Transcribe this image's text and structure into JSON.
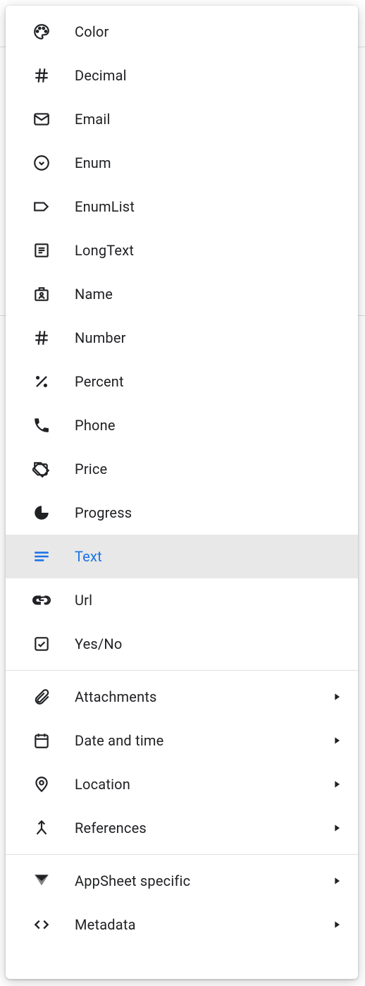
{
  "selected": "Text",
  "colors": {
    "text": "#202124",
    "accent": "#1a73e8",
    "selected_bg": "#e8e8e8",
    "divider": "#e0e0e0"
  },
  "groups": [
    {
      "name": "simple-types",
      "items": [
        {
          "label": "Color",
          "icon": "palette-icon"
        },
        {
          "label": "Decimal",
          "icon": "hash-icon"
        },
        {
          "label": "Email",
          "icon": "mail-icon"
        },
        {
          "label": "Enum",
          "icon": "circle-chevron-icon"
        },
        {
          "label": "EnumList",
          "icon": "label-icon"
        },
        {
          "label": "LongText",
          "icon": "document-lines-icon"
        },
        {
          "label": "Name",
          "icon": "badge-icon"
        },
        {
          "label": "Number",
          "icon": "hash-icon"
        },
        {
          "label": "Percent",
          "icon": "percent-icon"
        },
        {
          "label": "Phone",
          "icon": "phone-icon"
        },
        {
          "label": "Price",
          "icon": "tag-icon"
        },
        {
          "label": "Progress",
          "icon": "pie-icon"
        },
        {
          "label": "Text",
          "icon": "text-lines-icon",
          "selected": true
        },
        {
          "label": "Url",
          "icon": "link-icon"
        },
        {
          "label": "Yes/No",
          "icon": "checkbox-icon"
        }
      ]
    },
    {
      "name": "category-submenus-1",
      "items": [
        {
          "label": "Attachments",
          "icon": "paperclip-icon",
          "has_submenu": true
        },
        {
          "label": "Date and time",
          "icon": "calendar-icon",
          "has_submenu": true
        },
        {
          "label": "Location",
          "icon": "location-pin-icon",
          "has_submenu": true
        },
        {
          "label": "References",
          "icon": "merge-icon",
          "has_submenu": true
        }
      ]
    },
    {
      "name": "category-submenus-2",
      "items": [
        {
          "label": "AppSheet specific",
          "icon": "appsheet-icon",
          "has_submenu": true
        },
        {
          "label": "Metadata",
          "icon": "code-icon",
          "has_submenu": true
        }
      ]
    }
  ]
}
